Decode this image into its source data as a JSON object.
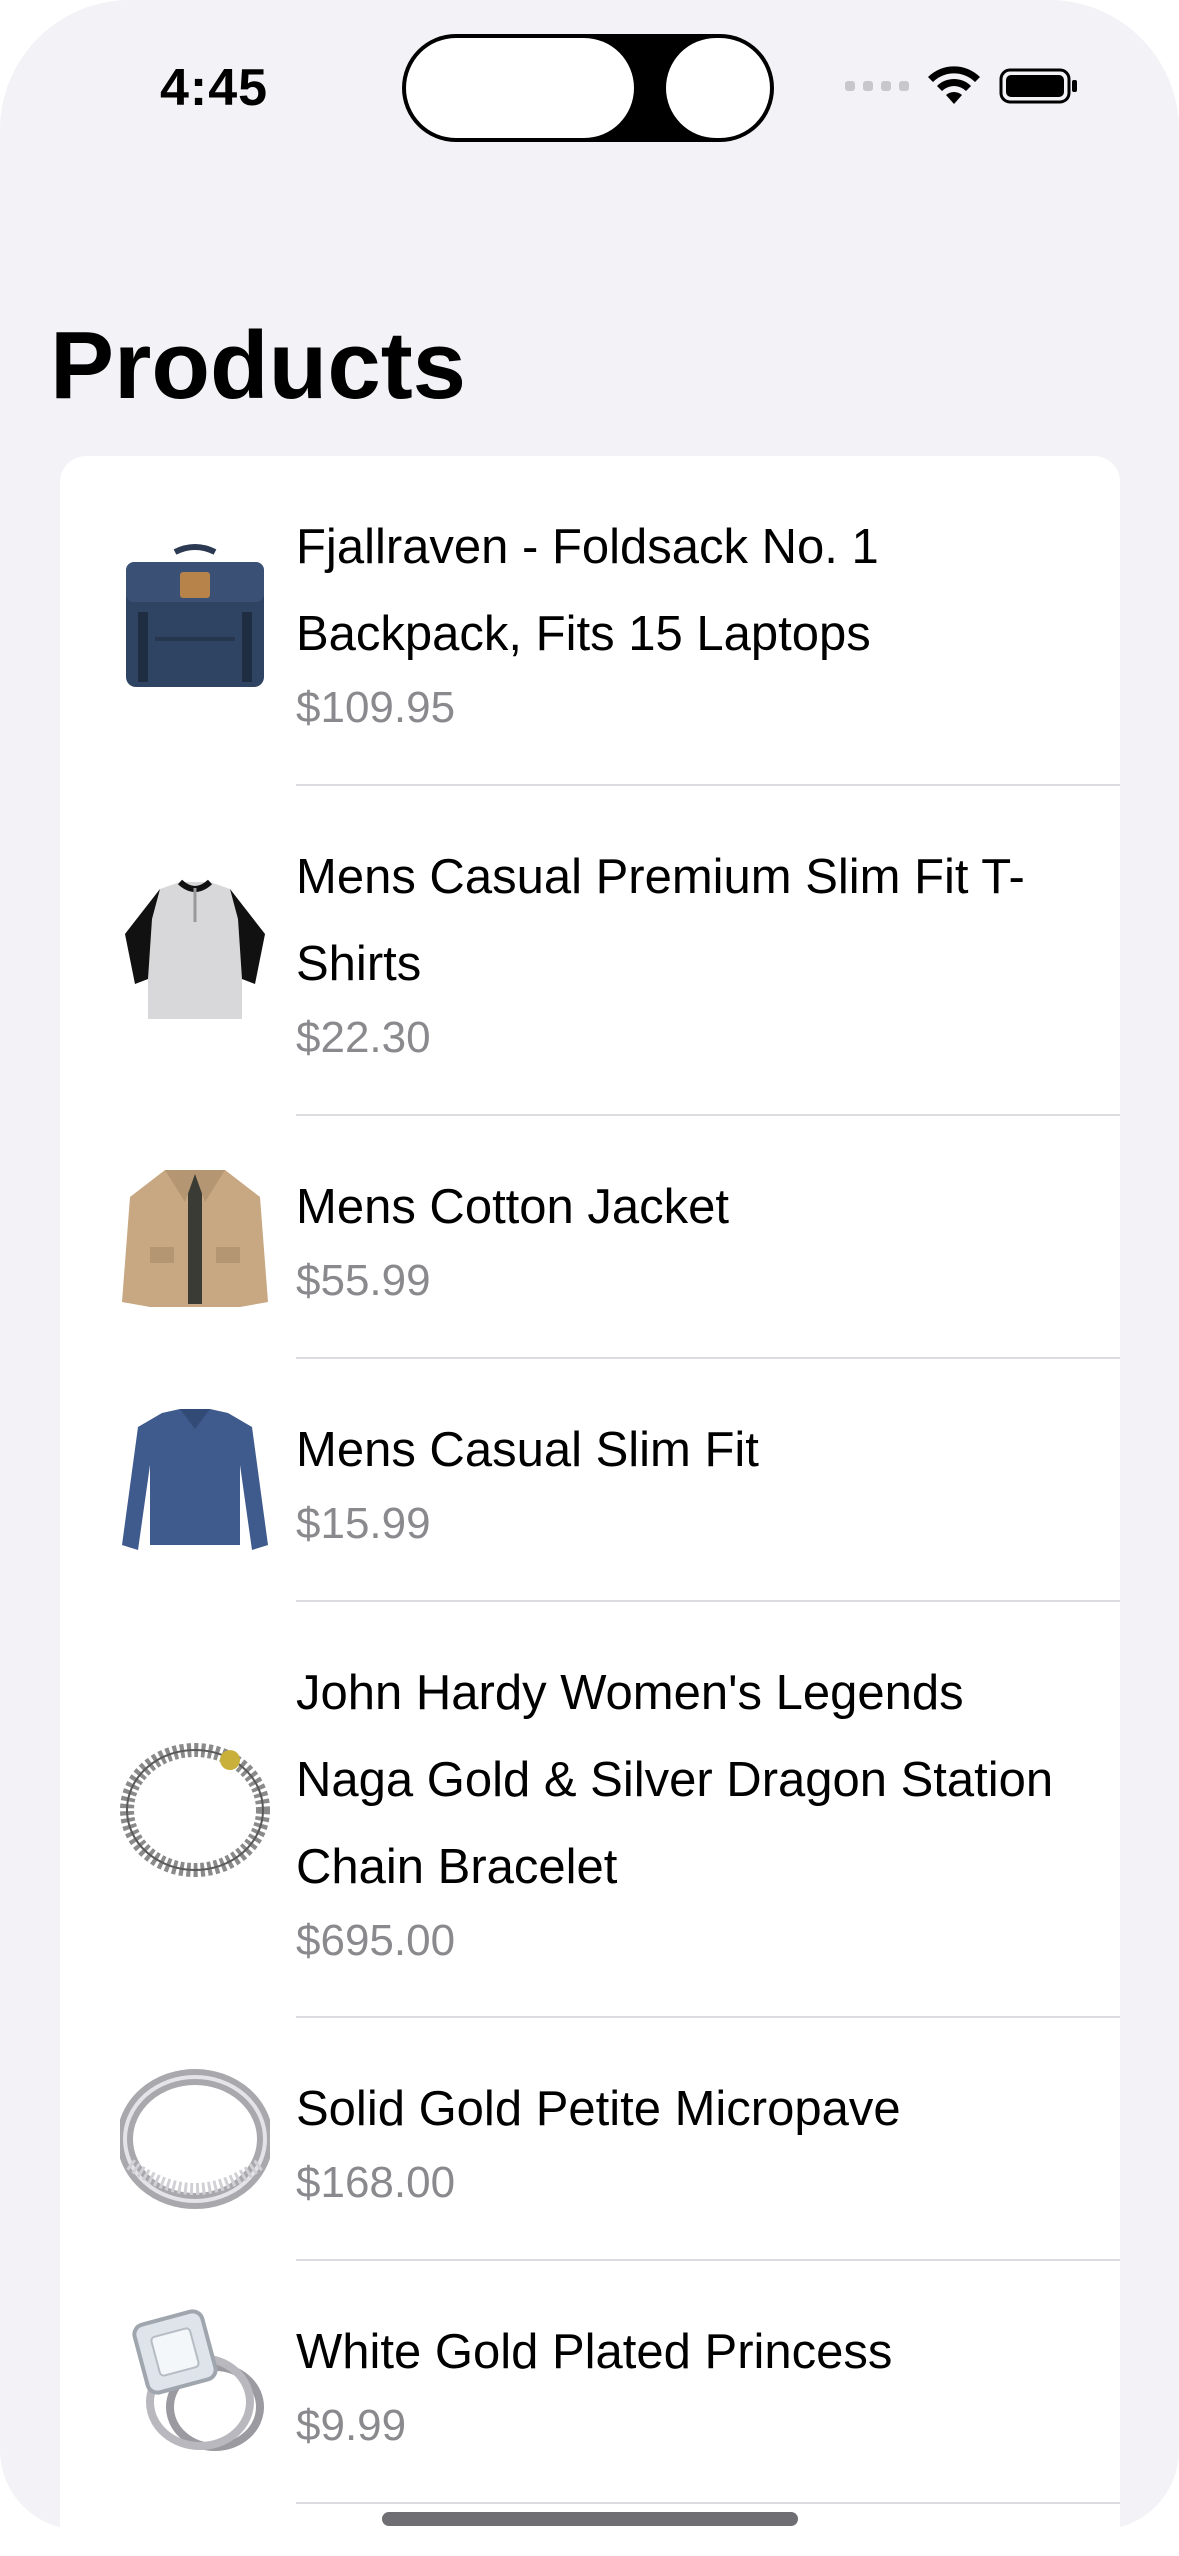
{
  "status_bar": {
    "time": "4:45"
  },
  "page": {
    "title": "Products"
  },
  "products": [
    {
      "title": "Fjallraven - Foldsack No. 1 Backpack, Fits 15 Laptops",
      "price": "$109.95",
      "icon": "backpack-image"
    },
    {
      "title": "Mens Casual Premium Slim Fit T-Shirts",
      "price": "$22.30",
      "icon": "tshirt-image"
    },
    {
      "title": "Mens Cotton Jacket",
      "price": "$55.99",
      "icon": "jacket-image"
    },
    {
      "title": "Mens Casual Slim Fit",
      "price": "$15.99",
      "icon": "longsleeve-shirt-image"
    },
    {
      "title": "John Hardy Women's Legends Naga Gold & Silver Dragon Station Chain Bracelet",
      "price": "$695.00",
      "icon": "bracelet-image"
    },
    {
      "title": "Solid Gold Petite Micropave",
      "price": "$168.00",
      "icon": "ring-image"
    },
    {
      "title": "White Gold Plated Princess",
      "price": "$9.99",
      "icon": "diamond-ring-image"
    }
  ],
  "colors": {
    "background": "#F2F2F7",
    "card": "#FFFFFF",
    "secondary_text": "#8A8A8E",
    "separator": "#DCDCE0"
  }
}
